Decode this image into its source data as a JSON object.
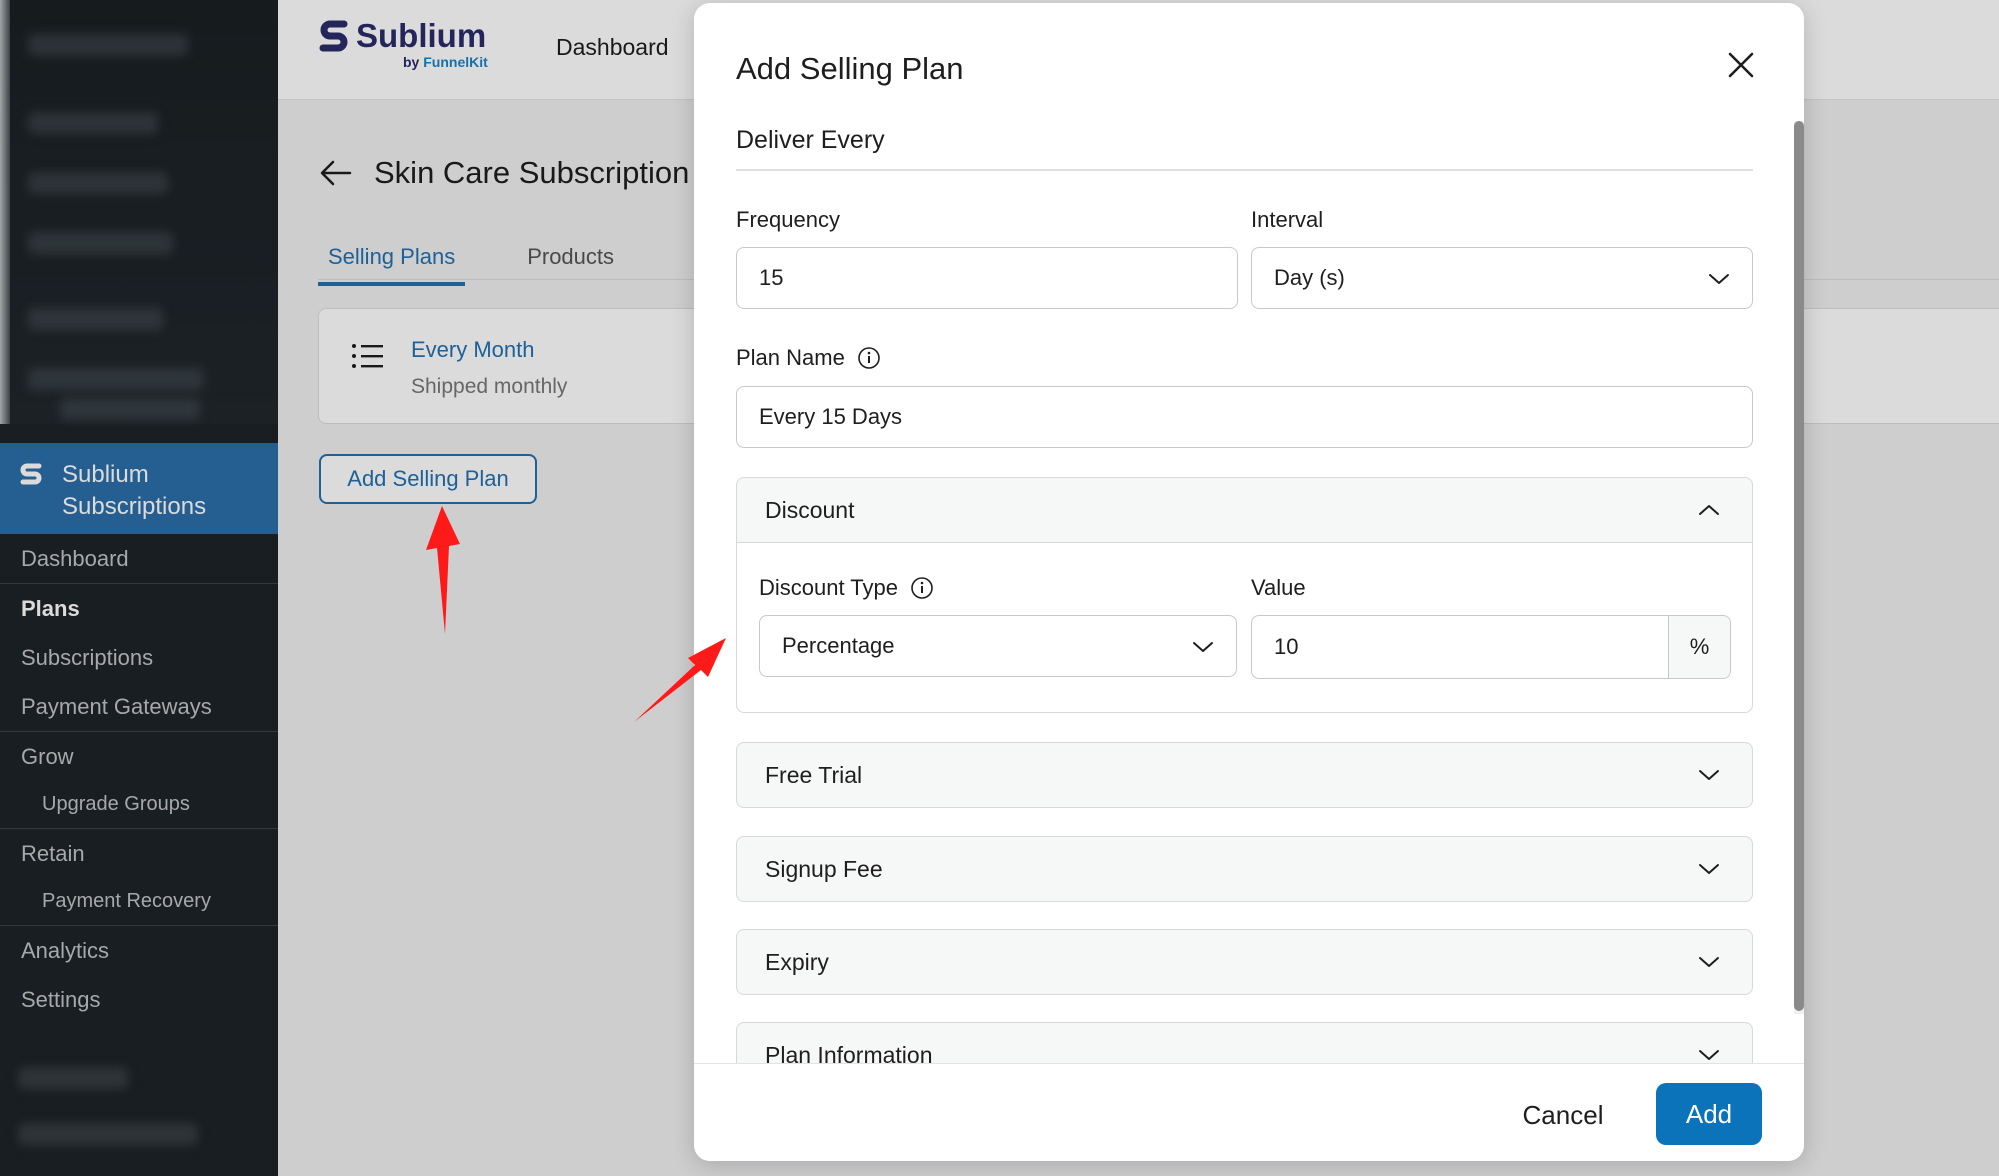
{
  "sidebar": {
    "brand": "Sublium Subscriptions",
    "items": [
      {
        "label": "Dashboard"
      },
      {
        "label": "Plans"
      },
      {
        "label": "Subscriptions"
      },
      {
        "label": "Payment Gateways"
      },
      {
        "label": "Grow"
      },
      {
        "label": "Upgrade Groups"
      },
      {
        "label": "Retain"
      },
      {
        "label": "Payment Recovery"
      },
      {
        "label": "Analytics"
      },
      {
        "label": "Settings"
      }
    ]
  },
  "topbar": {
    "brand_name": "Sublium",
    "brand_by": "by ",
    "brand_by_accent": "FunnelKit",
    "nav_dashboard": "Dashboard"
  },
  "page": {
    "title": "Skin Care Subscription",
    "tabs": [
      {
        "label": "Selling Plans"
      },
      {
        "label": "Products"
      }
    ],
    "plan": {
      "name": "Every Month",
      "description": "Shipped monthly"
    },
    "add_button": "Add Selling Plan"
  },
  "modal": {
    "title": "Add Selling Plan",
    "section": "Deliver Every",
    "frequency": {
      "label": "Frequency",
      "value": "15"
    },
    "interval": {
      "label": "Interval",
      "value": "Day (s)"
    },
    "plan_name": {
      "label": "Plan Name",
      "value": "Every 15 Days"
    },
    "discount": {
      "title": "Discount",
      "type_label": "Discount Type",
      "type_value": "Percentage",
      "value_label": "Value",
      "value": "10",
      "suffix": "%"
    },
    "sections": [
      {
        "title": "Free Trial"
      },
      {
        "title": "Signup Fee"
      },
      {
        "title": "Expiry"
      },
      {
        "title": "Plan Information"
      }
    ],
    "cancel": "Cancel",
    "add": "Add"
  },
  "colors": {
    "accent": "#2271b1",
    "primary_button": "#0a73b9",
    "sidebar_bg": "#1d2327",
    "sidebar_brand_bg": "#2c6fa9",
    "annotation_arrow": "#ff1a1a"
  }
}
